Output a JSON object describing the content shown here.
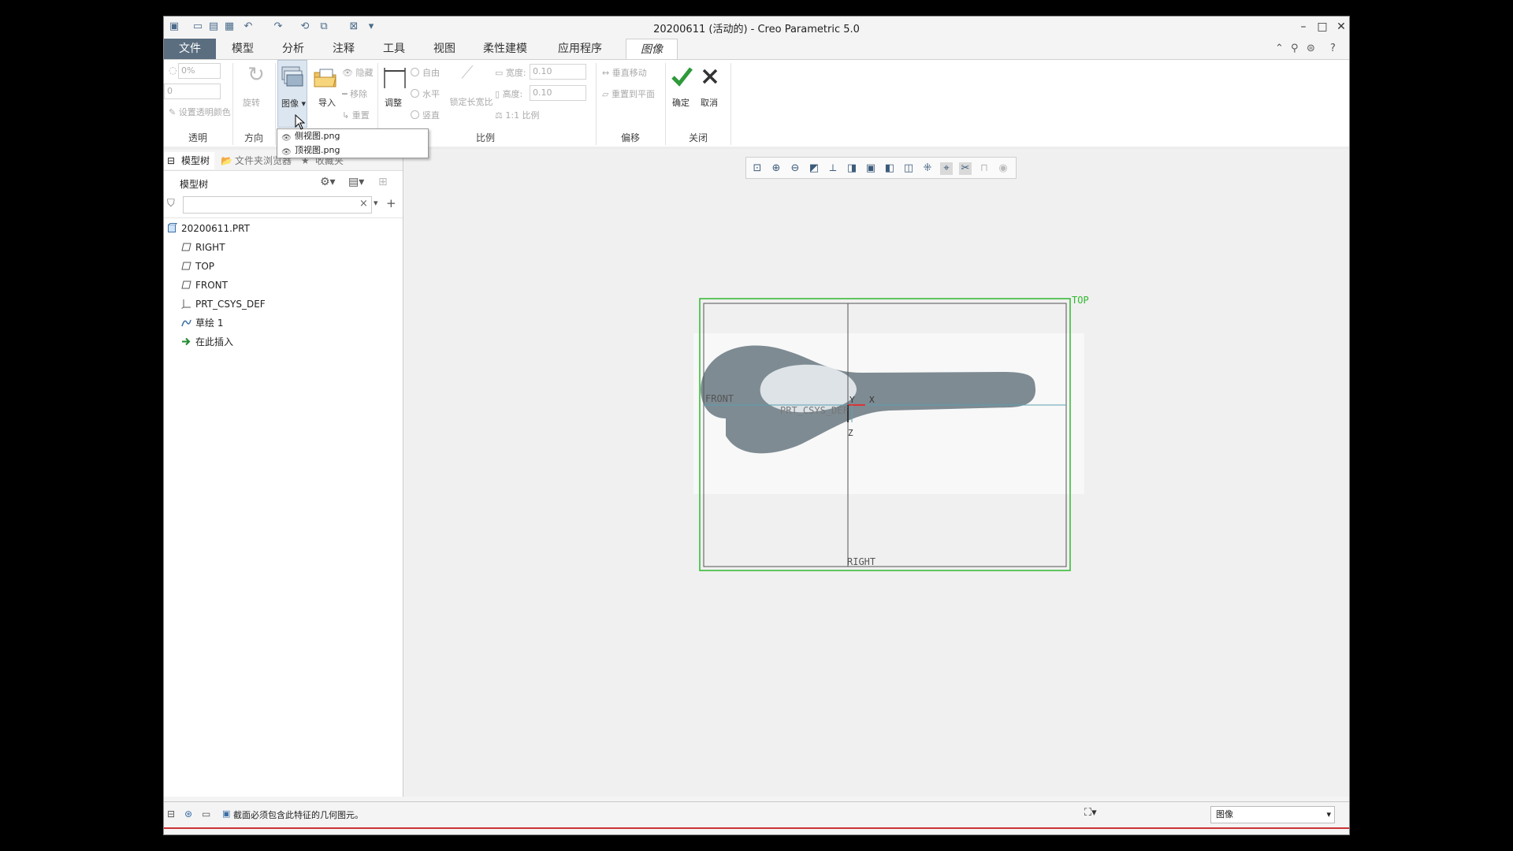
{
  "window": {
    "title": "20200611 (活动的) - Creo Parametric 5.0",
    "controls": {
      "minimize": "–",
      "maximize": "□",
      "close": "✕"
    }
  },
  "tabs": [
    {
      "label": "文件"
    },
    {
      "label": "模型"
    },
    {
      "label": "分析"
    },
    {
      "label": "注释"
    },
    {
      "label": "工具"
    },
    {
      "label": "视图"
    },
    {
      "label": "柔性建模"
    },
    {
      "label": "应用程序"
    },
    {
      "label": "图像"
    }
  ],
  "ribbon": {
    "transparency": {
      "percent": "0%",
      "value": "0",
      "set_color": "设置透明颜色",
      "group": "透明"
    },
    "orientation": {
      "rotate": "旋转",
      "group": "方向"
    },
    "image": {
      "image_btn": "图像",
      "import_btn": "导入",
      "hide": "隐藏",
      "remove": "移除",
      "reset": "重置"
    },
    "scale": {
      "adjust": "调整",
      "free": "自由",
      "horizontal": "水平",
      "vertical": "竖直",
      "lock_ratio": "锁定长宽比",
      "width_label": "宽度:",
      "width_value": "0.10",
      "height_label": "高度:",
      "height_value": "0.10",
      "one_to_one": "1:1 比例",
      "group": "比例"
    },
    "offset": {
      "move_vertical": "垂直移动",
      "reset_plane": "重置到平面",
      "group": "偏移"
    },
    "close": {
      "ok": "确定",
      "cancel": "取消",
      "group": "关闭"
    }
  },
  "dropdown": {
    "items": [
      {
        "label": "侧视图.png"
      },
      {
        "label": "顶视图.png"
      }
    ]
  },
  "left_panel": {
    "tabs": [
      "模型树",
      "文件夹浏览器",
      "收藏夹"
    ],
    "header": "模型树",
    "search_value": "",
    "tree": [
      {
        "label": "20200611.PRT",
        "icon": "part-icon"
      },
      {
        "label": "RIGHT",
        "icon": "datum-plane-icon"
      },
      {
        "label": "TOP",
        "icon": "datum-plane-icon"
      },
      {
        "label": "FRONT",
        "icon": "datum-plane-icon"
      },
      {
        "label": "PRT_CSYS_DEF",
        "icon": "csys-icon"
      },
      {
        "label": "草绘 1",
        "icon": "sketch-icon"
      },
      {
        "label": "在此插入",
        "icon": "insert-here-icon"
      }
    ]
  },
  "graphics": {
    "labels": {
      "top": "TOP",
      "front": "FRONT",
      "right": "RIGHT",
      "csys": "PRT_CSYS_DEF",
      "axis_x": "X",
      "axis_y": "Y",
      "axis_z": "Z"
    }
  },
  "status": {
    "message": "截面必须包含此特征的几何图元。",
    "filter_value": "图像"
  },
  "colors": {
    "file_tab": "#5b6e80",
    "datum_green": "#2db82d",
    "shape_gray": "#7e8b93",
    "ok_green": "#2e9a3a"
  }
}
